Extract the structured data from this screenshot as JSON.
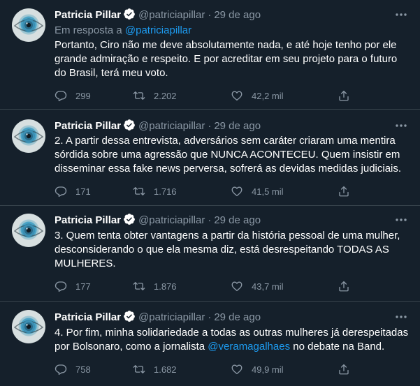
{
  "tweets": [
    {
      "name": "Patricia Pillar",
      "handle": "@patriciapillar",
      "date": "29 de ago",
      "reply_prefix": "Em resposta a ",
      "reply_handle": "@patriciapillar",
      "text": "Portanto, Ciro não me deve absolutamente nada, e até hoje tenho por ele grande admiração e respeito. E por acreditar em seu projeto para o futuro do Brasil, terá meu voto.",
      "replies": "299",
      "retweets": "2.202",
      "likes": "42,2 mil"
    },
    {
      "name": "Patricia Pillar",
      "handle": "@patriciapillar",
      "date": "29 de ago",
      "text": "2. A partir dessa entrevista, adversários sem caráter criaram uma mentira sórdida sobre uma agressão que NUNCA ACONTECEU. Quem insistir em disseminar essa fake news perversa, sofrerá as devidas medidas judiciais.",
      "replies": "171",
      "retweets": "1.716",
      "likes": "41,5 mil"
    },
    {
      "name": "Patricia Pillar",
      "handle": "@patriciapillar",
      "date": "29 de ago",
      "text": "3. Quem tenta obter vantagens a partir da história pessoal de uma mulher, desconsiderando o que ela mesma diz, está desrespeitando TODAS AS MULHERES.",
      "replies": "177",
      "retweets": "1.876",
      "likes": "43,7 mil"
    },
    {
      "name": "Patricia Pillar",
      "handle": "@patriciapillar",
      "date": "29 de ago",
      "text_before": "4. Por fim, minha solidariedade a todas as outras mulheres já derespeitadas por Bolsonaro, como a jornalista ",
      "text_link": "@veramagalhaes",
      "text_after": " no debate na Band.",
      "replies": "758",
      "retweets": "1.682",
      "likes": "49,9 mil"
    }
  ],
  "colors": {
    "background": "#15202b",
    "text": "#ffffff",
    "secondary": "#8b98a5",
    "link": "#1d9bf0",
    "divider": "#38444d"
  },
  "icons": {
    "verified": "verified-badge-icon",
    "more": "more-icon",
    "reply": "reply-icon",
    "retweet": "retweet-icon",
    "like": "like-icon",
    "share": "share-icon"
  }
}
